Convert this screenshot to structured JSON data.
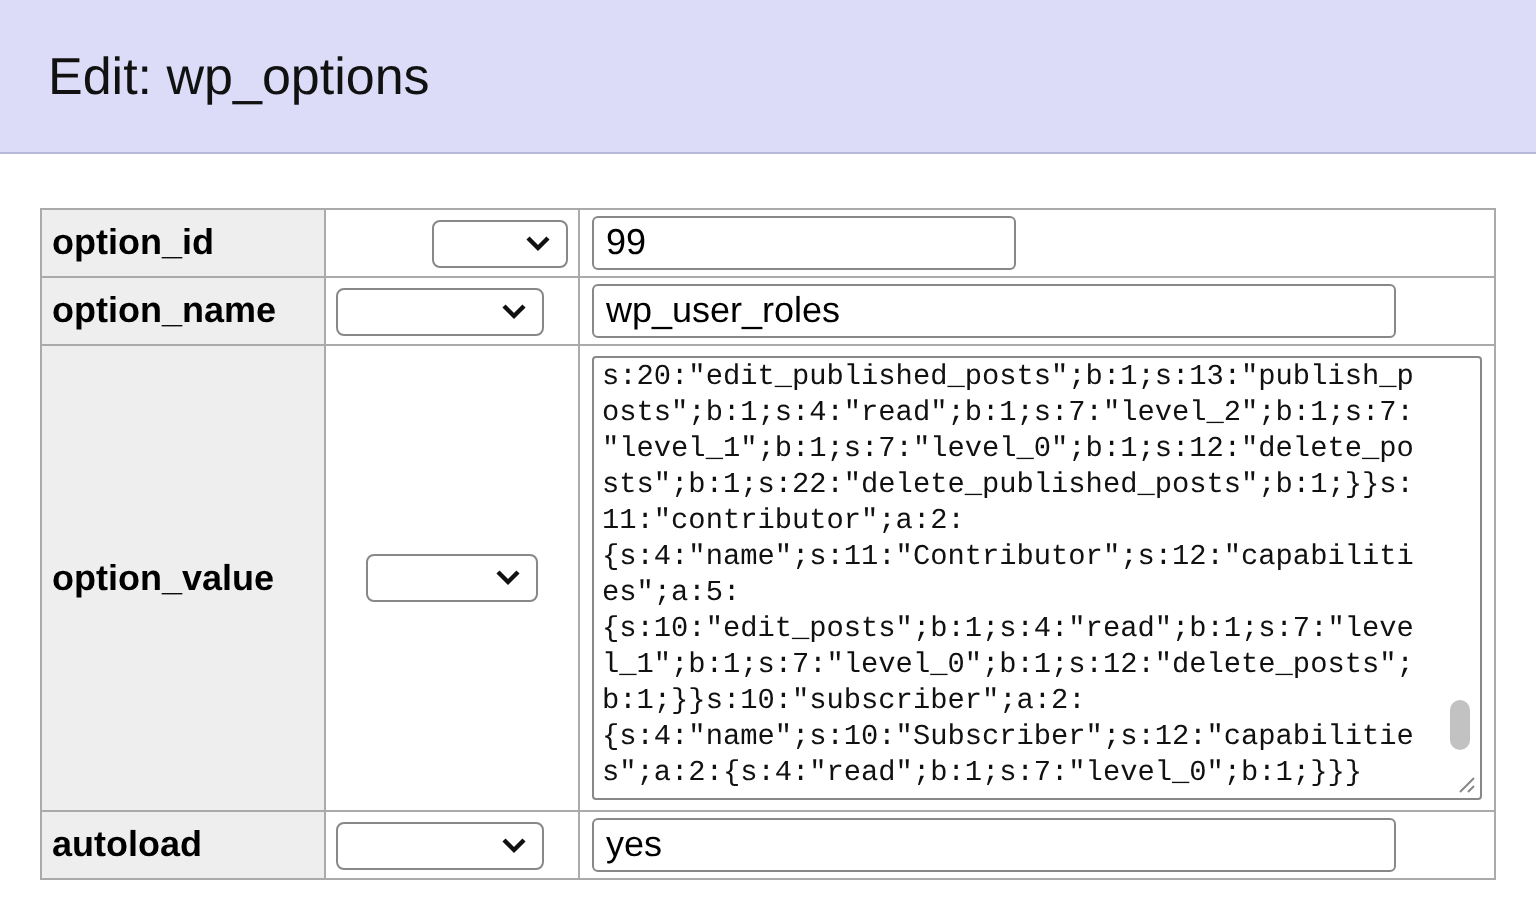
{
  "header": {
    "title": "Edit: wp_options"
  },
  "rows": [
    {
      "label": "option_id",
      "kind": "input",
      "value": "99"
    },
    {
      "label": "option_name",
      "kind": "input",
      "value": "wp_user_roles"
    },
    {
      "label": "option_value",
      "kind": "textarea",
      "lines": [
        "s:20:\"edit_published_posts\";b:1;s:13:\"publish_p",
        "osts\";b:1;s:4:\"read\";b:1;s:7:\"level_2\";b:1;s:7:",
        "\"level_1\";b:1;s:7:\"level_0\";b:1;s:12:\"delete_po",
        "sts\";b:1;s:22:\"delete_published_posts\";b:1;}}s:",
        "11:\"contributor\";a:2:",
        "{s:4:\"name\";s:11:\"Contributor\";s:12:\"capabiliti",
        "es\";a:5:",
        "{s:10:\"edit_posts\";b:1;s:4:\"read\";b:1;s:7:\"leve",
        "l_1\";b:1;s:7:\"level_0\";b:1;s:12:\"delete_posts\";",
        "b:1;}}s:10:\"subscriber\";a:2:",
        "{s:4:\"name\";s:10:\"Subscriber\";s:12:\"capabilitie",
        "s\";a:2:{s:4:\"read\";b:1;s:7:\"level_0\";b:1;}}}"
      ]
    },
    {
      "label": "autoload",
      "kind": "input",
      "value": "yes"
    }
  ]
}
